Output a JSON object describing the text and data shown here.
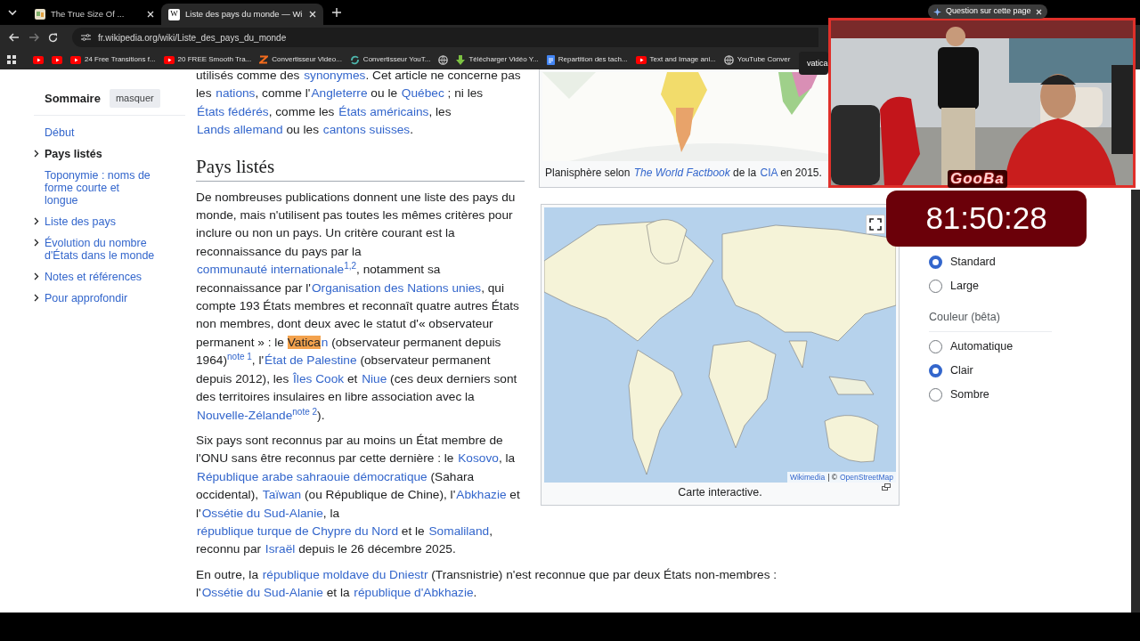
{
  "browser": {
    "tabs": [
      {
        "title": "The True Size Of ...",
        "selected": false,
        "kind": "map"
      },
      {
        "title": "Liste des pays du monde — Wi",
        "selected": true,
        "kind": "letter",
        "favicon_text": "W"
      }
    ],
    "address": "fr.wikipedia.org/wiki/Liste_des_pays_du_monde",
    "assistant_chip": "Question sur cette page",
    "bookmarks": [
      {
        "kind": "youtube"
      },
      {
        "kind": "youtube"
      },
      {
        "kind": "youtube",
        "label": "24 Free Transitions f..."
      },
      {
        "kind": "youtube",
        "label": "20 FREE Smooth Tra..."
      },
      {
        "kind": "zigzag",
        "label": "Convertisseur Video..."
      },
      {
        "kind": "swirl",
        "label": "Convertisseur YouT..."
      },
      {
        "kind": "globe"
      },
      {
        "kind": "download",
        "label": "Télécharger Vidéo Y..."
      },
      {
        "kind": "doc",
        "label": "Repartition des tach..."
      },
      {
        "kind": "youtube",
        "label": "Text and Image ani..."
      },
      {
        "kind": "globe",
        "label": "YouTube Conver"
      }
    ],
    "find_query": "vatica"
  },
  "sidebar": {
    "title": "Sommaire",
    "hide_button": "masquer",
    "items": [
      {
        "label": "Début",
        "selected": false,
        "has_subsections": false
      },
      {
        "label": "Pays listés",
        "selected": true,
        "has_subsections": true,
        "children": [
          {
            "label": "Toponymie : noms de forme courte et longue",
            "selected": false,
            "has_subsections": false
          }
        ]
      },
      {
        "label": "Liste des pays",
        "selected": false,
        "has_subsections": true
      },
      {
        "label": "Évolution du nombre d'États dans le monde",
        "selected": false,
        "has_subsections": true
      },
      {
        "label": "Notes et références",
        "selected": false,
        "has_subsections": true
      },
      {
        "label": "Pour approfondir",
        "selected": false,
        "has_subsections": true
      }
    ]
  },
  "article": {
    "top_figure": {
      "kind": "picture",
      "caption": [
        {
          "kind": "text",
          "text": "Planisphère selon "
        },
        {
          "kind": "link",
          "text": "*The World Factbook*"
        },
        {
          "kind": "text",
          "text": " de la "
        },
        {
          "kind": "link",
          "text": "CIA"
        },
        {
          "kind": "text",
          "text": " en 2015."
        }
      ]
    },
    "intro": [
      {
        "kind": "text",
        "text": "utilisés comme des "
      },
      {
        "kind": "link",
        "text": "synonymes"
      },
      {
        "kind": "text",
        "text": ". Cet article ne concerne pas les "
      },
      {
        "kind": "link",
        "text": "nations"
      },
      {
        "kind": "text",
        "text": ", comme l'"
      },
      {
        "kind": "link",
        "text": "Angleterre"
      },
      {
        "kind": "text",
        "text": " ou le "
      },
      {
        "kind": "link",
        "text": "Québec"
      },
      {
        "kind": "text",
        "text": " ; ni les "
      },
      {
        "kind": "link",
        "text": "États fédérés"
      },
      {
        "kind": "text",
        "text": ", comme les "
      },
      {
        "kind": "link",
        "text": "États américains"
      },
      {
        "kind": "text",
        "text": ", les "
      },
      {
        "kind": "link",
        "text": "Lands allemand"
      },
      {
        "kind": "text",
        "text": " ou les "
      },
      {
        "kind": "link",
        "text": "cantons suisses"
      },
      {
        "kind": "text",
        "text": "."
      }
    ],
    "heading": "Pays listés",
    "map_figure": {
      "kind": "picture",
      "attribution": [
        "Wikimedia",
        "OpenStreetMap"
      ],
      "attribution_separator": "| ©",
      "caption": "Carte interactive."
    },
    "paragraphs": [
      [
        {
          "kind": "text",
          "text": "De nombreuses publications donnent une liste des pays du monde, mais n'utilisent pas toutes les mêmes critères pour inclure ou non un pays. Un critère courant est la reconnaissance du pays par la "
        },
        {
          "kind": "link",
          "text": "communauté internationale"
        },
        {
          "kind": "sup",
          "text": "1,2"
        },
        {
          "kind": "text",
          "text": ", notamment sa reconnaissance par l'"
        },
        {
          "kind": "link",
          "text": "Organisation des Nations unies"
        },
        {
          "kind": "text",
          "text": ", qui compte 193 États membres et reconnaît quatre autres États non membres, dont deux avec le statut d'« observateur permanent » : le "
        },
        {
          "kind": "highlight",
          "text": "Vatica"
        },
        {
          "kind": "link",
          "text": "n"
        },
        {
          "kind": "text",
          "text": " (observateur permanent depuis 1964)"
        },
        {
          "kind": "sup",
          "text": "note 1"
        },
        {
          "kind": "text",
          "text": ", l'"
        },
        {
          "kind": "link",
          "text": "État de Palestine"
        },
        {
          "kind": "text",
          "text": " (observateur permanent depuis 2012), les "
        },
        {
          "kind": "link",
          "text": "Îles Cook"
        },
        {
          "kind": "text",
          "text": " et "
        },
        {
          "kind": "link",
          "text": "Niue"
        },
        {
          "kind": "text",
          "text": " (ces deux derniers sont des territoires insulaires en libre association avec la "
        },
        {
          "kind": "link",
          "text": "Nouvelle-Zélande"
        },
        {
          "kind": "sup",
          "text": "note 2"
        },
        {
          "kind": "text",
          "text": ")."
        }
      ],
      [
        {
          "kind": "text",
          "text": "Six pays sont reconnus par au moins un État membre de l'ONU sans être reconnus par cette dernière : le "
        },
        {
          "kind": "link",
          "text": "Kosovo"
        },
        {
          "kind": "text",
          "text": ", la "
        },
        {
          "kind": "link",
          "text": "République arabe sahraouie démocratique"
        },
        {
          "kind": "text",
          "text": " (Sahara occidental), "
        },
        {
          "kind": "link",
          "text": "Taïwan"
        },
        {
          "kind": "text",
          "text": " (ou République de Chine), l'"
        },
        {
          "kind": "link",
          "text": "Abkhazie"
        },
        {
          "kind": "text",
          "text": " et l'"
        },
        {
          "kind": "link",
          "text": "Ossétie du Sud-Alanie"
        },
        {
          "kind": "text",
          "text": ", la "
        },
        {
          "kind": "link",
          "text": "république turque de Chypre du Nord"
        },
        {
          "kind": "text",
          "text": " et le "
        },
        {
          "kind": "link",
          "text": "Somaliland"
        },
        {
          "kind": "text",
          "text": ", reconnu par "
        },
        {
          "kind": "link",
          "text": "Israël"
        },
        {
          "kind": "text",
          "text": " depuis le 26 décembre 2025."
        }
      ],
      [
        {
          "kind": "text",
          "text": "En outre, la "
        },
        {
          "kind": "link",
          "text": "république moldave du Dniestr"
        },
        {
          "kind": "text",
          "text": " (Transnistrie) n'est reconnue que par deux États non-membres : l'"
        },
        {
          "kind": "link",
          "text": "Ossétie du Sud-Alanie"
        },
        {
          "kind": "text",
          "text": " et la "
        },
        {
          "kind": "link",
          "text": "république d'Abkhazie"
        },
        {
          "kind": "text",
          "text": "."
        }
      ]
    ]
  },
  "appearance": {
    "size_options": [
      {
        "label": "Standard",
        "selected": true
      },
      {
        "label": "Large",
        "selected": false
      }
    ],
    "color_heading": "Couleur (bêta)",
    "color_options": [
      {
        "label": "Automatique",
        "selected": false
      },
      {
        "label": "Clair",
        "selected": true
      },
      {
        "label": "Sombre",
        "selected": false
      }
    ]
  },
  "overlay": {
    "channel_logo": "GooBa",
    "timer": "81:50:28"
  }
}
